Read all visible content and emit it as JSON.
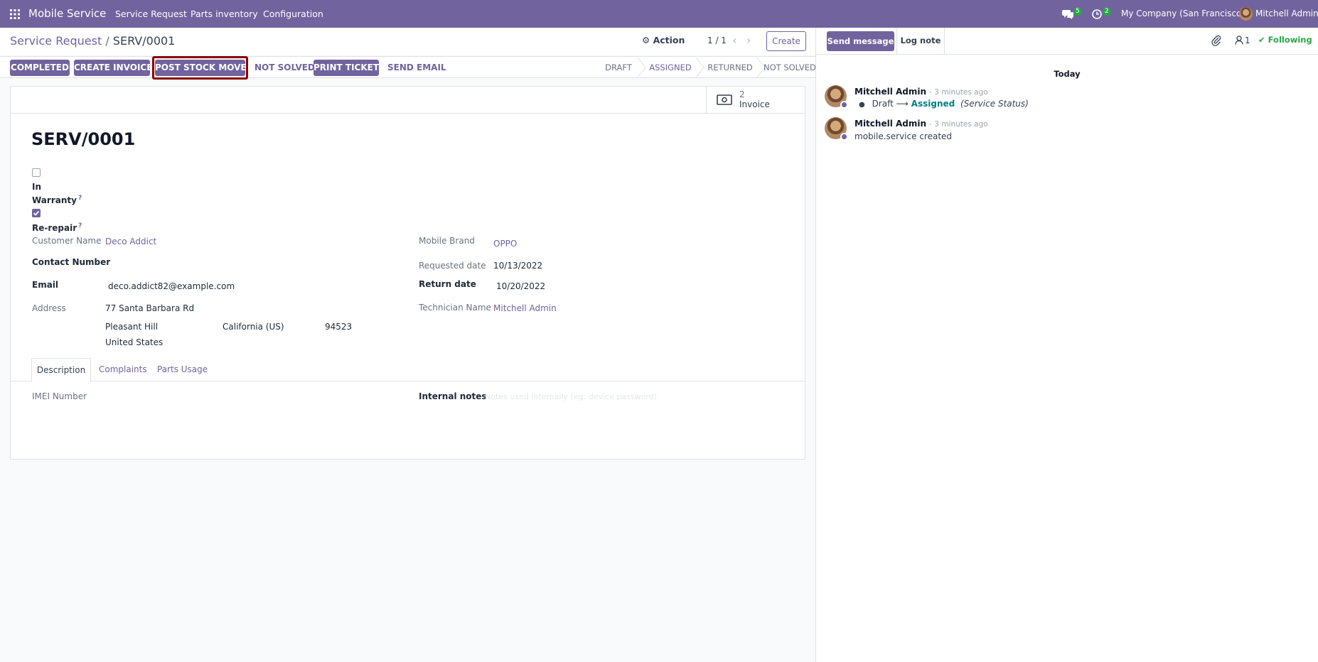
{
  "navbar": {
    "app_name": "Mobile Service",
    "menu": [
      "Service Request",
      "Parts inventory",
      "Configuration"
    ],
    "messages_count": "5",
    "activities_count": "2",
    "company": "My Company (San Francisco)",
    "user": "Mitchell Admin",
    "color": "#71639e"
  },
  "breadcrumb": {
    "parent": "Service Request",
    "sep": "/",
    "current": "SERV/0001"
  },
  "action_label": "Action",
  "pager": "1 / 1",
  "create_label": "Create",
  "header_buttons": {
    "completed": "COMPLETED",
    "create_invoice": "CREATE INVOICE",
    "post_stock_moves": "POST STOCK MOVES",
    "not_solved": "NOT SOLVED",
    "print_ticket": "PRINT TICKET",
    "send_email": "SEND EMAIL"
  },
  "stages": [
    "DRAFT",
    "ASSIGNED",
    "RETURNED",
    "NOT SOLVED"
  ],
  "smart_button": {
    "count": "2",
    "label": "Invoice"
  },
  "record": {
    "title": "SERV/0001",
    "in_warranty_label_1": "In",
    "in_warranty_label_2": "Warranty",
    "in_warranty_checked": false,
    "rerepair_label": "Re-repair",
    "rerepair_checked": true,
    "help_mark": "?",
    "customer_name_label": "Customer Name",
    "customer_name": "Deco Addict",
    "contact_number_label": "Contact Number",
    "email_label": "Email",
    "email": "deco.addict82@example.com",
    "address_label": "Address",
    "street": "77 Santa Barbara Rd",
    "city": "Pleasant Hill",
    "state": "California (US)",
    "zip": "94523",
    "country": "United States",
    "mobile_brand_label": "Mobile Brand",
    "mobile_brand": "OPPO",
    "requested_date_label": "Requested date",
    "requested_date": "10/13/2022",
    "return_date_label": "Return date",
    "return_date": "10/20/2022",
    "technician_label": "Technician Name",
    "technician": "Mitchell Admin"
  },
  "tabs": [
    "Description",
    "Complaints",
    "Parts Usage"
  ],
  "description_tab": {
    "imei_label": "IMEI Number",
    "internal_notes_label": "Internal notes",
    "internal_notes_placeholder": "Notes used internally (eg: device password)"
  },
  "chatter": {
    "send_message": "Send message",
    "log_note": "Log note",
    "followers_count": "1",
    "following": "Following",
    "date_separator": "Today",
    "messages": [
      {
        "author": "Mitchell Admin",
        "time": "- 3 minutes ago",
        "from": "Draft",
        "arrow": "⟶",
        "to": "Assigned",
        "field": "(Service Status)"
      },
      {
        "author": "Mitchell Admin",
        "time": "- 3 minutes ago",
        "body": "mobile.service created"
      }
    ]
  },
  "highlight_color": "#8b0000",
  "success_color": "#28a745"
}
